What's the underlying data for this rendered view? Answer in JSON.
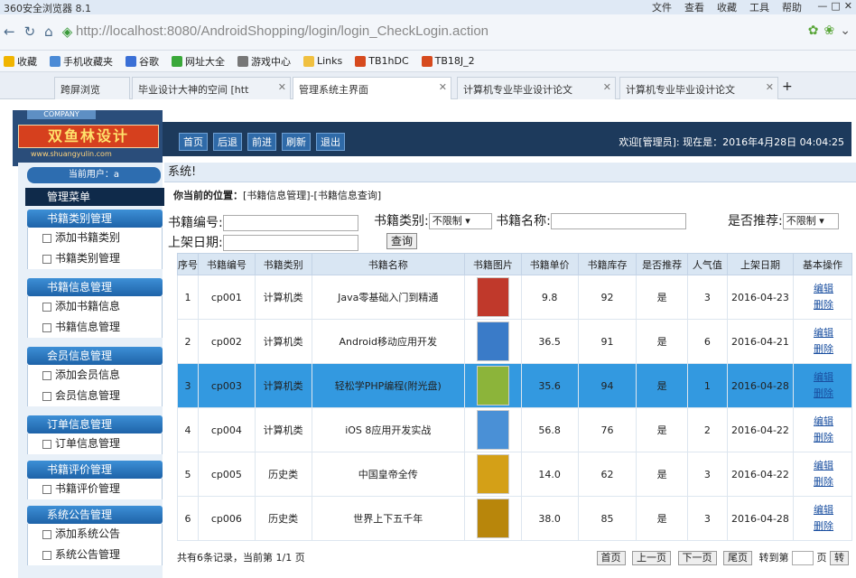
{
  "browser": {
    "title": "360安全浏览器 8.1",
    "menu": [
      "文件",
      "查看",
      "收藏",
      "工具",
      "帮助"
    ],
    "url_host": "http://localhost",
    "url_rest": ":8080/AndroidShopping/login/login_CheckLogin.action",
    "bookmarks": [
      "收藏",
      "手机收藏夹",
      "谷歌",
      "网址大全",
      "游戏中心",
      "Links",
      "TB1hDC",
      "TB18J_2"
    ],
    "tabs": [
      "跨屏浏览",
      "毕业设计大神的空间 [htt",
      "管理系统主界面",
      "计算机专业毕业设计论文",
      "计算机专业毕业设计论文"
    ]
  },
  "brand": {
    "company": "COMPANY",
    "name": "双鱼林设计",
    "site": "www.shuangyulin.com"
  },
  "topnav": {
    "buttons": [
      "首页",
      "后退",
      "前进",
      "刷新",
      "退出"
    ],
    "welcome": "欢迎[管理员]:  现在是：2016年4月28日 04:04:25"
  },
  "sidebar": {
    "current_user": "当前用户：a",
    "menu_title": "管理菜单",
    "groups": [
      {
        "title": "书籍类别管理",
        "items": [
          "添加书籍类别",
          "书籍类别管理"
        ]
      },
      {
        "title": "书籍信息管理",
        "items": [
          "添加书籍信息",
          "书籍信息管理"
        ]
      },
      {
        "title": "会员信息管理",
        "items": [
          "添加会员信息",
          "会员信息管理"
        ]
      },
      {
        "title": "订单信息管理",
        "items": [
          "订单信息管理"
        ]
      },
      {
        "title": "书籍评价管理",
        "items": [
          "书籍评价管理"
        ]
      },
      {
        "title": "系统公告管理",
        "items": [
          "添加系统公告",
          "系统公告管理"
        ]
      }
    ]
  },
  "content": {
    "sys": "系统!",
    "crumb_label": "你当前的位置：",
    "crumb": "[书籍信息管理]-[书籍信息查询]",
    "search": {
      "no_label": "书籍编号:",
      "type_label": "书籍类别:",
      "type_value": "不限制",
      "name_label": "书籍名称:",
      "rec_label": "是否推荐:",
      "rec_value": "不限制",
      "date_label": "上架日期:",
      "query": "查询"
    },
    "columns": [
      "序号",
      "书籍编号",
      "书籍类别",
      "书籍名称",
      "书籍图片",
      "书籍单价",
      "书籍库存",
      "是否推荐",
      "人气值",
      "上架日期",
      "基本操作"
    ],
    "rows": [
      [
        "1",
        "cp001",
        "计算机类",
        "Java零基础入门到精通",
        "9.8",
        "92",
        "是",
        "3",
        "2016-04-23"
      ],
      [
        "2",
        "cp002",
        "计算机类",
        "Android移动应用开发",
        "36.5",
        "91",
        "是",
        "6",
        "2016-04-21"
      ],
      [
        "3",
        "cp003",
        "计算机类",
        "轻松学PHP编程(附光盘)",
        "35.6",
        "94",
        "是",
        "1",
        "2016-04-28"
      ],
      [
        "4",
        "cp004",
        "计算机类",
        "iOS 8应用开发实战",
        "56.8",
        "76",
        "是",
        "2",
        "2016-04-22"
      ],
      [
        "5",
        "cp005",
        "历史类",
        "中国皇帝全传",
        "14.0",
        "62",
        "是",
        "3",
        "2016-04-22"
      ],
      [
        "6",
        "cp006",
        "历史类",
        "世界上下五千年",
        "38.0",
        "85",
        "是",
        "3",
        "2016-04-28"
      ]
    ],
    "edit": "编辑",
    "del": "删除",
    "footer": {
      "summary": "共有6条记录，当前第 1/1 页",
      "first": "首页",
      "prev": "上一页",
      "next": "下一页",
      "last": "尾页",
      "goto": "转到第",
      "page": "页",
      "go": "转"
    }
  },
  "colors": {
    "nav": "#1d3a5c",
    "highlight": "#3399e0",
    "group": "#1e63a8"
  }
}
